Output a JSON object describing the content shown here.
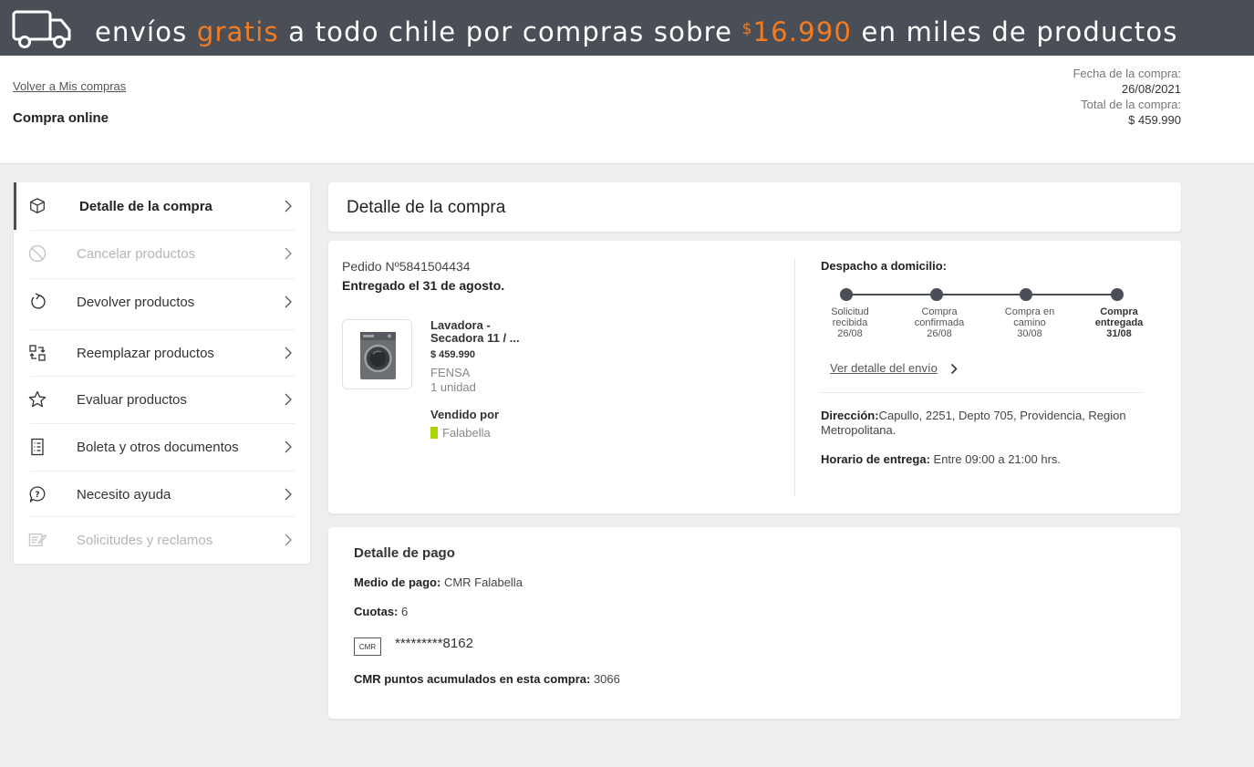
{
  "banner": {
    "part1": "envíos",
    "highlight": "gratis",
    "part2": "a todo chile por compras sobre",
    "currency": "$",
    "amount": "16.990",
    "part3": "en miles de productos",
    "icon": "truck-icon"
  },
  "header": {
    "back_link": "Volver a Mis compras",
    "title": "Compra online",
    "date_label": "Fecha de la compra:",
    "date_value": "26/08/2021",
    "total_label": "Total de la compra:",
    "total_value": "$ 459.990"
  },
  "sidebar": {
    "items": [
      {
        "label": "Detalle de la compra",
        "icon": "box-icon",
        "state": "active"
      },
      {
        "label": "Cancelar productos",
        "icon": "cancel-icon",
        "state": "disabled"
      },
      {
        "label": "Devolver productos",
        "icon": "return-icon",
        "state": "normal"
      },
      {
        "label": "Reemplazar productos",
        "icon": "replace-icon",
        "state": "normal"
      },
      {
        "label": "Evaluar productos",
        "icon": "star-icon",
        "state": "normal"
      },
      {
        "label": "Boleta y otros documentos",
        "icon": "document-icon",
        "state": "normal"
      },
      {
        "label": "Necesito ayuda",
        "icon": "help-icon",
        "state": "normal"
      },
      {
        "label": "Solicitudes y reclamos",
        "icon": "claims-icon",
        "state": "disabled"
      }
    ]
  },
  "main": {
    "title": "Detalle de la compra"
  },
  "order": {
    "number": "Pedido Nº5841504434",
    "delivered": "Entregado el 31 de agosto.",
    "product": {
      "name_line1": "Lavadora -",
      "name_line2": "Secadora 11 / ...",
      "price": "$ 459.990",
      "brand": "FENSA",
      "quantity": "1 unidad",
      "sold_by_label": "Vendido por",
      "seller": "Falabella"
    },
    "shipping": {
      "title": "Despacho a domicilio:",
      "steps": [
        {
          "line1": "Solicitud",
          "line2": "recibida",
          "date": "26/08",
          "current": false
        },
        {
          "line1": "Compra",
          "line2": "confirmada",
          "date": "26/08",
          "current": false
        },
        {
          "line1": "Compra en",
          "line2": "camino",
          "date": "30/08",
          "current": false
        },
        {
          "line1": "Compra",
          "line2": "entregada",
          "date": "31/08",
          "current": true
        }
      ],
      "detail_link": "Ver detalle del envío",
      "address_label": "Dirección:",
      "address_value": "Capullo, 2251, Depto 705, Providencia, Region Metropolitana.",
      "hours_label": "Horario de entrega:",
      "hours_value": " Entre 09:00 a 21:00 hrs."
    }
  },
  "payment": {
    "title": "Detalle de pago",
    "method_label": "Medio de pago:",
    "method_value": " CMR Falabella",
    "installments_label": "Cuotas:",
    "installments_value": " 6",
    "card_badge": "CMR",
    "card_number": "*********8162",
    "points_label": "CMR puntos acumulados en esta compra:",
    "points_value": " 3066"
  },
  "colors": {
    "banner_bg": "#4a4f57",
    "accent_orange": "#f47b20",
    "falabella_green": "#aad500"
  }
}
